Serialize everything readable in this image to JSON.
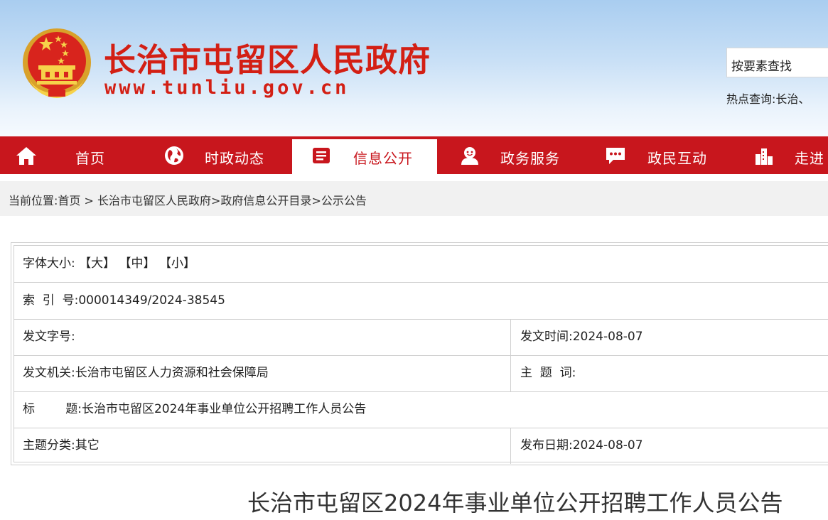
{
  "header": {
    "site_title": "长治市屯留区人民政府",
    "site_url": "www.tunliu.gov.cn",
    "search_placeholder": "按要素查找",
    "hot_search_label": "热点查询:",
    "hot_search_value": "长治、"
  },
  "nav": {
    "items": [
      {
        "label": "首页",
        "icon": "home-icon"
      },
      {
        "label": "时政动态",
        "icon": "globe-icon"
      },
      {
        "label": "信息公开",
        "icon": "document-icon",
        "active": true
      },
      {
        "label": "政务服务",
        "icon": "service-icon"
      },
      {
        "label": "政民互动",
        "icon": "chat-icon"
      },
      {
        "label": "走进",
        "icon": "city-icon"
      }
    ]
  },
  "breadcrumb": {
    "prefix": "当前位置:",
    "home": "首页",
    "sep1": " > ",
    "item1": "长治市屯留区人民政府",
    "sep2": ">",
    "item2": "政府信息公开目录",
    "sep3": ">",
    "item3": "公示公告"
  },
  "info": {
    "font_size_label": "字体大小:",
    "font_large": "【大】",
    "font_medium": "【中】",
    "font_small": "【小】",
    "index_label": "索  引  号:",
    "index_value": "000014349/2024-38545",
    "doc_no_label": "发文字号:",
    "doc_no_value": "",
    "issue_time_label": "发文时间:",
    "issue_time_value": "2024-08-07",
    "issuer_label": "发文机关:",
    "issuer_value": "长治市屯留区人力资源和社会保障局",
    "keywords_label": "主  题  词:",
    "keywords_value": "",
    "title_label": "标        题:",
    "title_value": "长治市屯留区2024年事业单位公开招聘工作人员公告",
    "category_label": "主题分类:",
    "category_value": "其它",
    "publish_date_label": "发布日期:",
    "publish_date_value": "2024-08-07"
  },
  "article": {
    "title": "长治市屯留区2024年事业单位公开招聘工作人员公告"
  },
  "colors": {
    "brand_red": "#c8161d",
    "title_red": "#d31f14",
    "header_blue": "#a9cdf0"
  }
}
